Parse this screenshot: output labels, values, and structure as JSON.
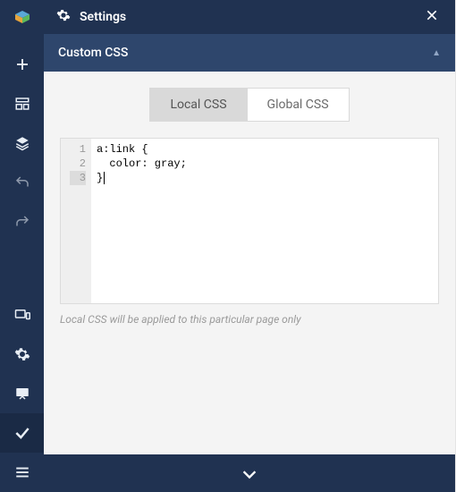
{
  "header": {
    "title": "Settings"
  },
  "section": {
    "title": "Custom CSS"
  },
  "tabs": {
    "local": "Local CSS",
    "global": "Global CSS",
    "active": "local"
  },
  "editor": {
    "lines": [
      "a:link {",
      "  color: gray;",
      "}"
    ],
    "gutter": [
      "1",
      "2",
      "3"
    ],
    "cursor_line": 3
  },
  "hint": "Local CSS will be applied to this particular page only",
  "colors": {
    "rail": "#203251",
    "section": "#2e466c"
  }
}
